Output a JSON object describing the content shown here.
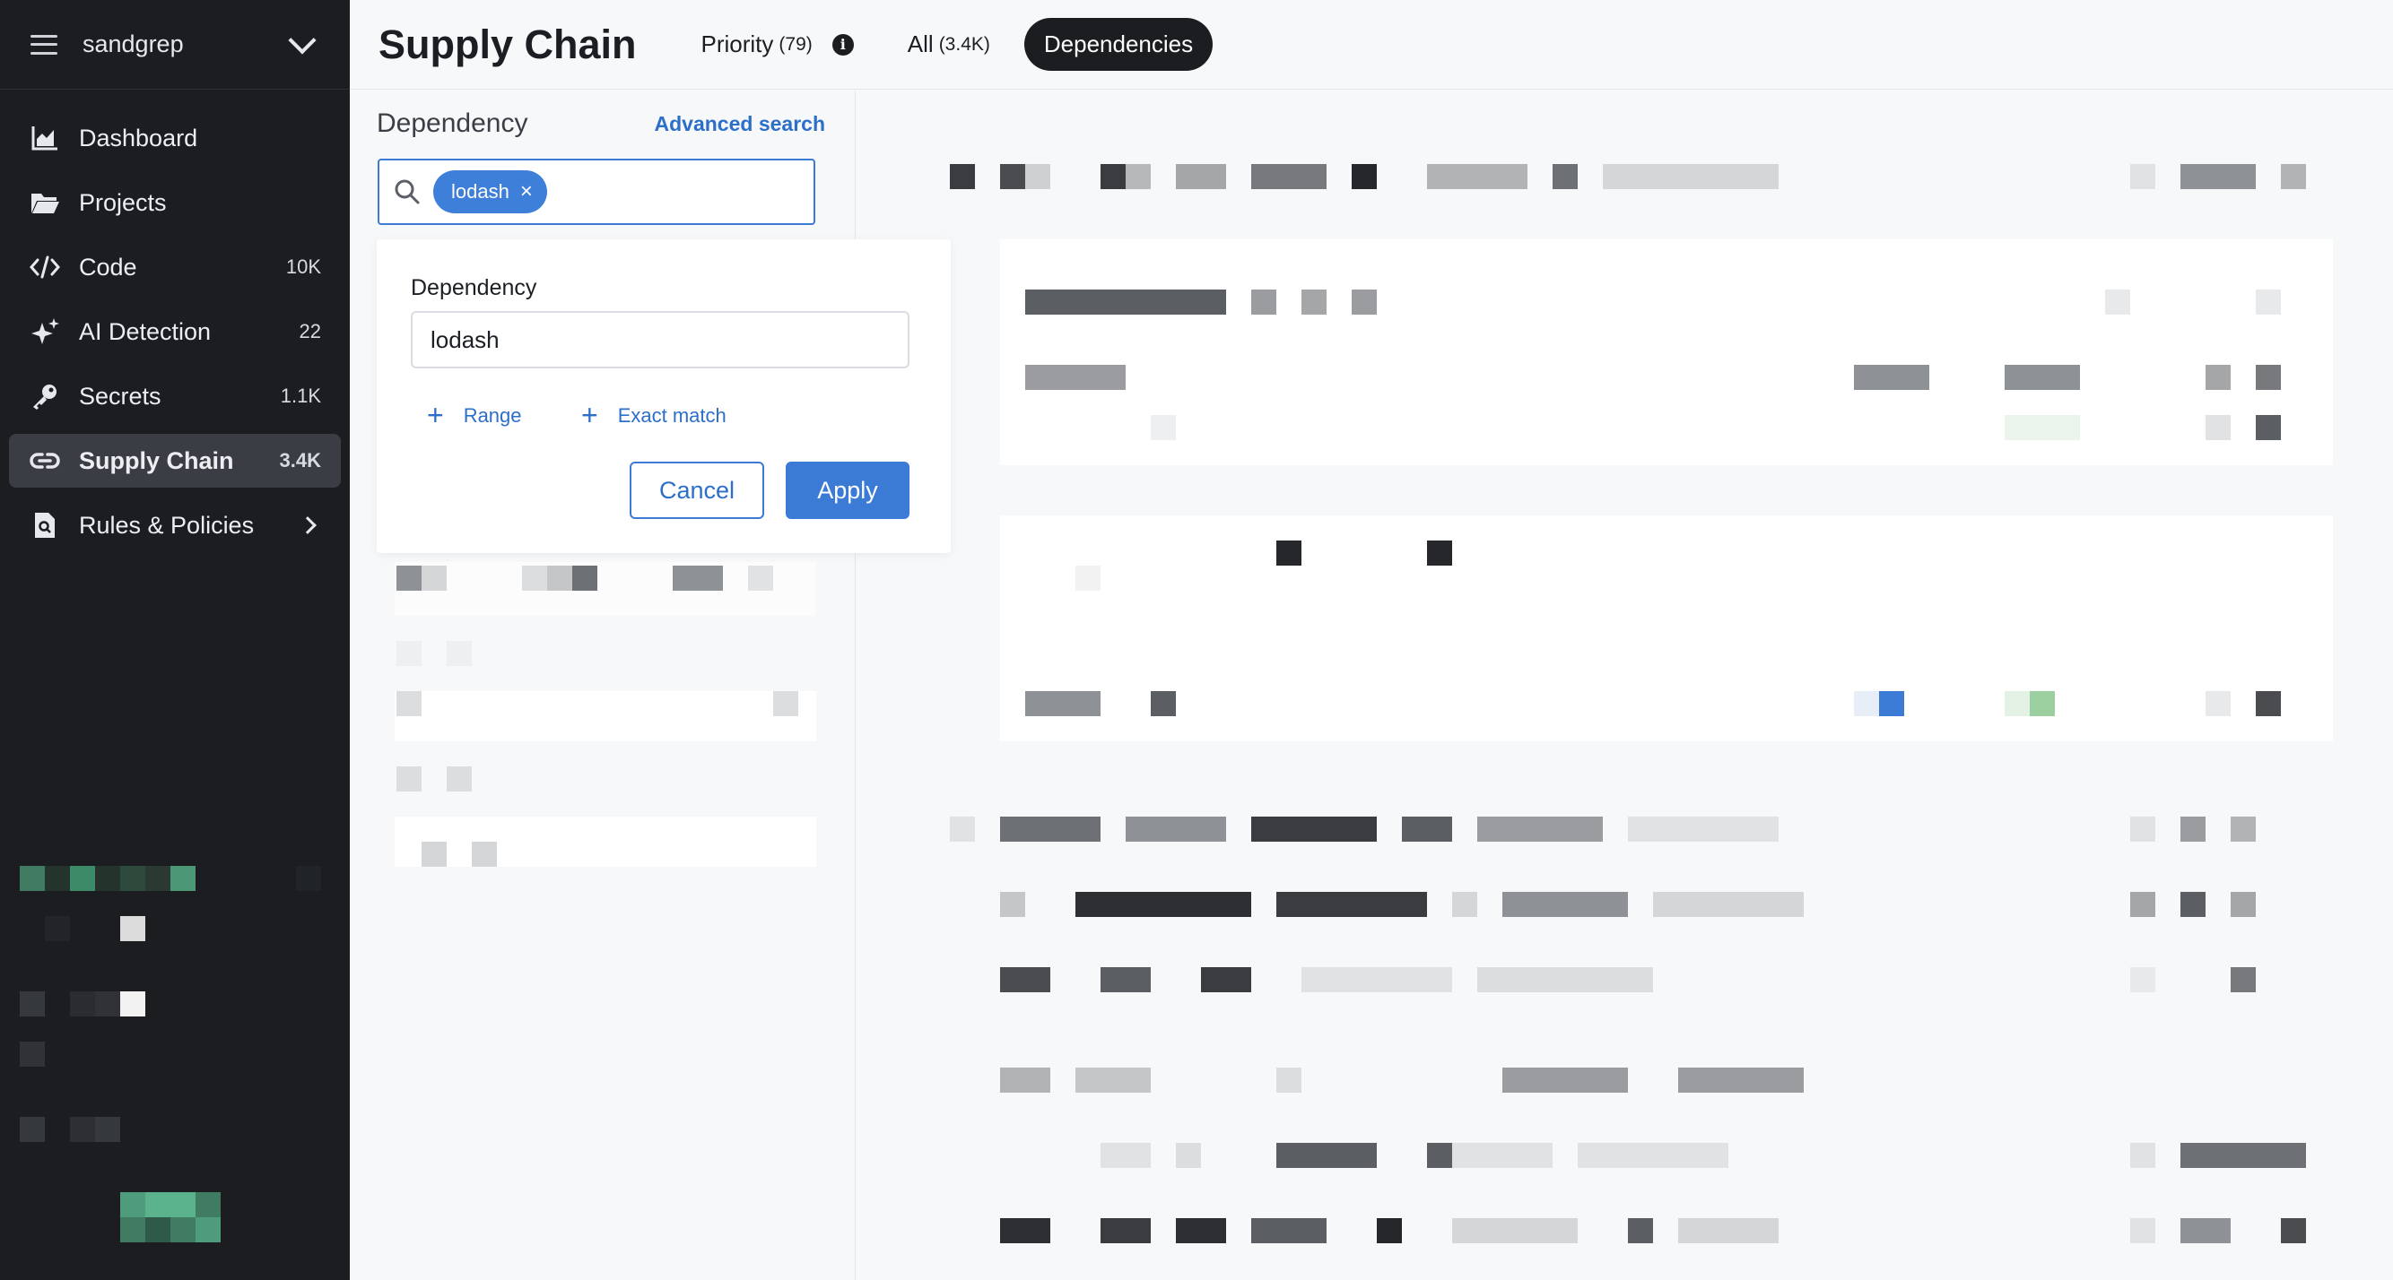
{
  "sidebar": {
    "org_name": "sandgrep",
    "items": [
      {
        "label": "Dashboard",
        "count": "",
        "icon": "chart-icon"
      },
      {
        "label": "Projects",
        "count": "",
        "icon": "folder-icon"
      },
      {
        "label": "Code",
        "count": "10K",
        "icon": "code-icon"
      },
      {
        "label": "AI Detection",
        "count": "22",
        "icon": "sparkle-icon"
      },
      {
        "label": "Secrets",
        "count": "1.1K",
        "icon": "key-icon"
      },
      {
        "label": "Supply Chain",
        "count": "3.4K",
        "icon": "link-icon"
      },
      {
        "label": "Rules & Policies",
        "count": "",
        "icon": "policy-doc-icon"
      }
    ]
  },
  "header": {
    "title": "Supply Chain",
    "tabs": [
      {
        "label": "Priority",
        "count": "(79)"
      },
      {
        "label": "All",
        "count": "(3.4K)"
      },
      {
        "label": "Dependencies",
        "count": ""
      }
    ]
  },
  "filter": {
    "title": "Dependency",
    "advanced_link": "Advanced search",
    "chip": "lodash",
    "popover": {
      "label": "Dependency",
      "value": "lodash",
      "range_label": "Range",
      "exact_label": "Exact match",
      "cancel": "Cancel",
      "apply": "Apply"
    }
  },
  "colors": {
    "sidebar_bg": "#1b1d21",
    "accent": "#3b7bd6",
    "active_item": "#3a3d44"
  }
}
